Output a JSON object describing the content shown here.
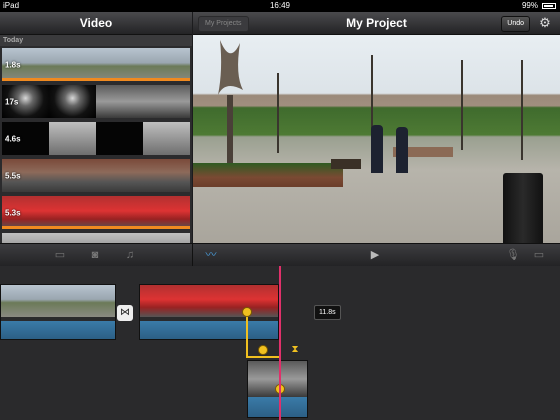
{
  "status_bar": {
    "device": "iPad",
    "time": "16:49",
    "battery": "99%"
  },
  "browser": {
    "title": "Video",
    "section": "Today",
    "clips": [
      {
        "duration": "1.8s",
        "used": true,
        "thumbs": [
          "park",
          "park",
          "park",
          "park"
        ]
      },
      {
        "duration": "17s",
        "used": false,
        "thumbs": [
          "dark",
          "dark",
          "people",
          "people"
        ]
      },
      {
        "duration": "4.6s",
        "used": false,
        "thumbs": [
          "black",
          "gray",
          "black",
          "gray"
        ]
      },
      {
        "duration": "5.5s",
        "used": false,
        "thumbs": [
          "street",
          "street",
          "street",
          "street"
        ]
      },
      {
        "duration": "5.3s",
        "used": true,
        "thumbs": [
          "bus",
          "bus",
          "bus",
          "bus"
        ]
      },
      {
        "duration": "",
        "used": false,
        "thumbs": [
          "gray",
          "gray",
          "gray",
          "gray"
        ]
      }
    ]
  },
  "project": {
    "back_label": "My Projects",
    "title": "My Project",
    "undo_label": "Undo"
  },
  "timeline": {
    "selected_duration": "11.8s"
  }
}
